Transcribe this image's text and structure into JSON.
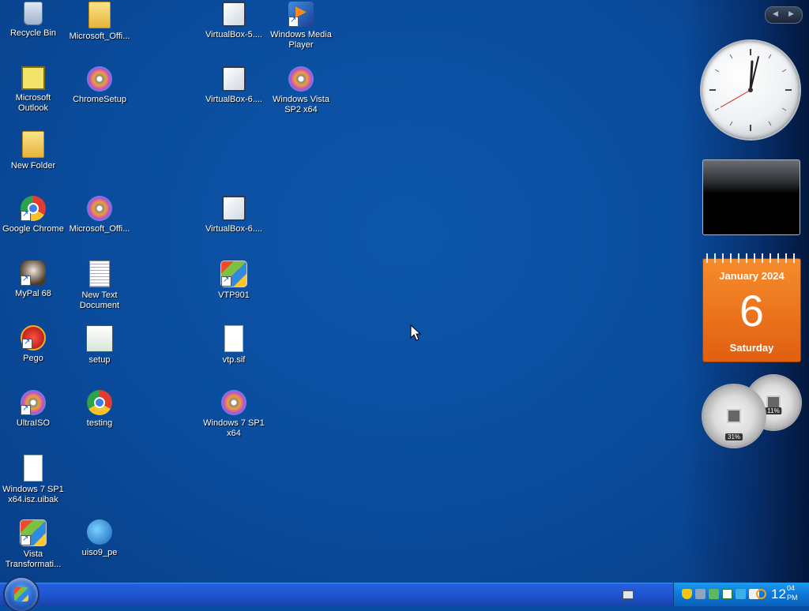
{
  "desktop": {
    "icons": [
      {
        "label": "Recycle Bin",
        "icon": "recycle-bin-icon",
        "shortcut": false
      },
      {
        "label": "Microsoft_Offi...",
        "icon": "folder-icon",
        "shortcut": false
      },
      {
        "label": "VirtualBox-5....",
        "icon": "virtualbox-icon",
        "shortcut": false
      },
      {
        "label": "Windows Media Player",
        "icon": "windows-media-player-icon",
        "shortcut": true
      },
      {
        "label": "Microsoft Outlook",
        "icon": "outlook-icon",
        "shortcut": false
      },
      {
        "label": "ChromeSetup",
        "icon": "chrome-setup-icon",
        "shortcut": false
      },
      {
        "label": "VirtualBox-6....",
        "icon": "virtualbox-icon",
        "shortcut": false
      },
      {
        "label": "Windows Vista SP2 x64",
        "icon": "disc-image-icon",
        "shortcut": false
      },
      {
        "label": "New Folder",
        "icon": "folder-icon",
        "shortcut": false
      },
      {
        "label": "Google Chrome",
        "icon": "chrome-icon",
        "shortcut": true
      },
      {
        "label": "Microsoft_Offi...",
        "icon": "disc-image-icon",
        "shortcut": false
      },
      {
        "label": "VirtualBox-6....",
        "icon": "virtualbox-icon",
        "shortcut": false
      },
      {
        "label": "MyPal 68",
        "icon": "mypal-icon",
        "shortcut": true
      },
      {
        "label": "New Text Document",
        "icon": "text-document-icon",
        "shortcut": false
      },
      {
        "label": "VTP901",
        "icon": "windows-logo-icon",
        "shortcut": true
      },
      {
        "label": "Pego",
        "icon": "pego-icon",
        "shortcut": true
      },
      {
        "label": "setup",
        "icon": "setup-icon",
        "shortcut": false
      },
      {
        "label": "vtp.sif",
        "icon": "blank-file-icon",
        "shortcut": false
      },
      {
        "label": "UltraISO",
        "icon": "ultraiso-icon",
        "shortcut": true
      },
      {
        "label": "testing",
        "icon": "chrome-icon",
        "shortcut": false
      },
      {
        "label": "Windows 7 SP1 x64",
        "icon": "disc-image-icon",
        "shortcut": false
      },
      {
        "label": "Windows 7 SP1 x64.isz.uibak",
        "icon": "blank-file-icon",
        "shortcut": false
      },
      {
        "label": "Vista Transformati...",
        "icon": "windows-logo-icon",
        "shortcut": true
      },
      {
        "label": "uiso9_pe",
        "icon": "globe-disc-icon",
        "shortcut": false
      }
    ]
  },
  "gadgets": {
    "nav_prev": "◀",
    "nav_next": "▶",
    "calendar": {
      "month": "January 2024",
      "day": "6",
      "weekday": "Saturday"
    },
    "cpu_meter": {
      "cpu_percent": "31%",
      "memory_percent": "11%"
    }
  },
  "taskbar": {
    "clock": {
      "hour": "12",
      "minute": "04",
      "ampm": "PM"
    }
  },
  "colors": {
    "desktop_background": "#0a4ea1",
    "taskbar": "#1f55d3",
    "calendar_orange": "#f07a1e"
  }
}
